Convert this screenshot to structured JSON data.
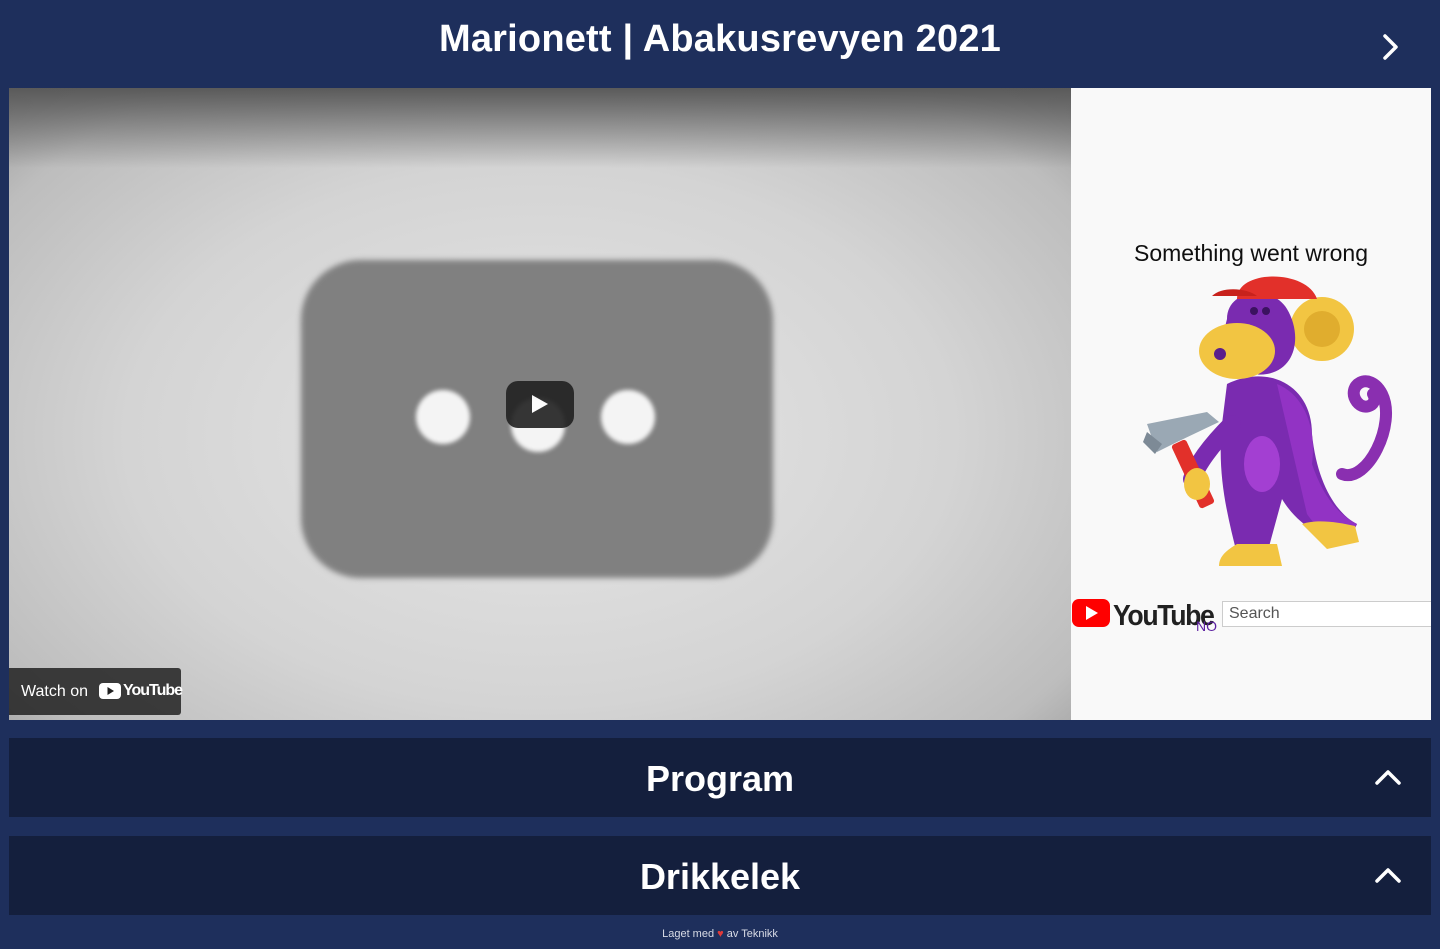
{
  "header": {
    "title": "Marionett | Abakusrevyen 2021",
    "next_icon": "chevron-right-icon"
  },
  "video": {
    "play_icon": "play-icon",
    "watch_on_label": "Watch on",
    "watch_on_brand": "YouTube"
  },
  "error_panel": {
    "title": "Something went wrong",
    "illustration": "monkey-with-hammer",
    "brand": "YouTube",
    "country": "NO",
    "search_placeholder": "Search"
  },
  "sections": [
    {
      "label": "Program",
      "icon": "chevron-up-icon"
    },
    {
      "label": "Drikkelek",
      "icon": "chevron-up-icon"
    }
  ],
  "footer": {
    "prefix": "Laget med",
    "heart": "♥",
    "suffix": "av Teknikk"
  },
  "colors": {
    "page_background": "#1e2f5c",
    "section_background": "#141f3d",
    "youtube_red": "#ff0000",
    "heart": "#e03a3a"
  }
}
